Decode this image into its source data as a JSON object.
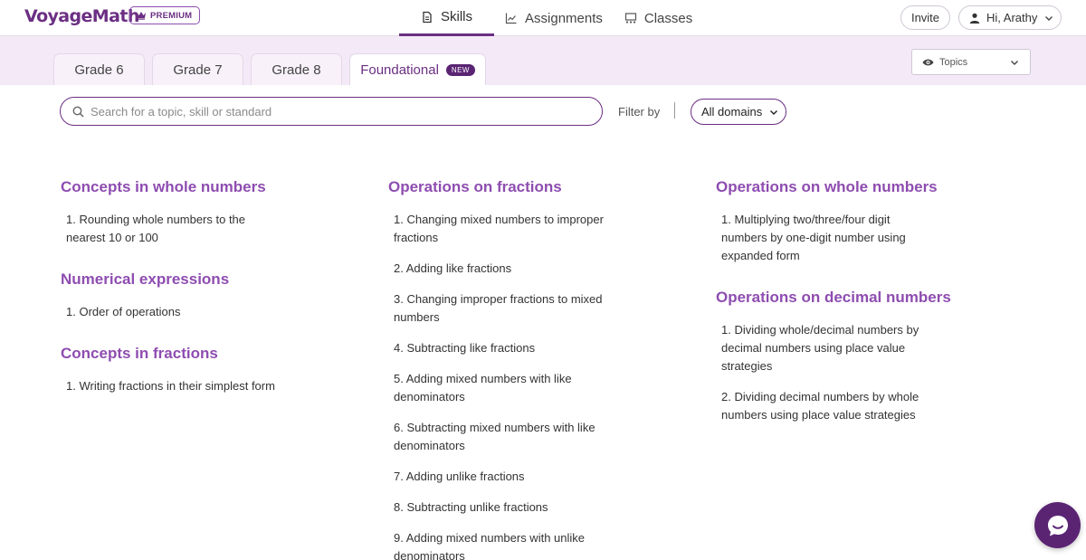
{
  "brand": {
    "logo_text": "VoyageMath",
    "premium_label": "PREMIUM"
  },
  "nav": {
    "tabs": [
      {
        "label": "Skills",
        "icon": "document-icon",
        "active": true
      },
      {
        "label": "Assignments",
        "icon": "chart-icon",
        "active": false
      },
      {
        "label": "Classes",
        "icon": "classes-icon",
        "active": false
      }
    ],
    "invite_label": "Invite",
    "user_greeting": "Hi, Arathy"
  },
  "grades": {
    "tabs": [
      {
        "label": "Grade 6",
        "active": false
      },
      {
        "label": "Grade 7",
        "active": false
      },
      {
        "label": "Grade 8",
        "active": false
      },
      {
        "label": "Foundational",
        "active": true,
        "badge": "NEW"
      }
    ],
    "topics_label": "Topics"
  },
  "search": {
    "placeholder": "Search for a topic, skill or standard",
    "value": ""
  },
  "filter": {
    "label": "Filter by",
    "selected": "All domains"
  },
  "columns": [
    [
      {
        "title": "Concepts in whole numbers",
        "skills": [
          "1. Rounding whole numbers to the nearest 10 or 100"
        ]
      },
      {
        "title": "Numerical expressions",
        "skills": [
          "1. Order of operations"
        ]
      },
      {
        "title": "Concepts in fractions",
        "skills": [
          "1. Writing fractions in their simplest form"
        ]
      }
    ],
    [
      {
        "title": "Operations on fractions",
        "skills": [
          "1. Changing mixed numbers to improper fractions",
          "2. Adding like fractions",
          "3. Changing improper fractions to mixed numbers",
          "4. Subtracting like fractions",
          "5. Adding mixed numbers with like denominators",
          "6. Subtracting mixed numbers with like denominators",
          "7. Adding unlike fractions",
          "8. Subtracting unlike fractions",
          "9. Adding mixed numbers with unlike denominators"
        ]
      }
    ],
    [
      {
        "title": "Operations on whole numbers",
        "skills": [
          "1. Multiplying two/three/four digit numbers by one-digit number using expanded form"
        ]
      },
      {
        "title": "Operations on decimal numbers",
        "skills": [
          "1. Dividing whole/decimal numbers by decimal numbers using place value strategies",
          "2. Dividing decimal numbers by whole numbers using place value strategies"
        ]
      }
    ]
  ],
  "colors": {
    "brand": "#6b2f83",
    "accent": "#8e4db0",
    "band": "#f4eaf7",
    "badge": "#5a2473"
  }
}
